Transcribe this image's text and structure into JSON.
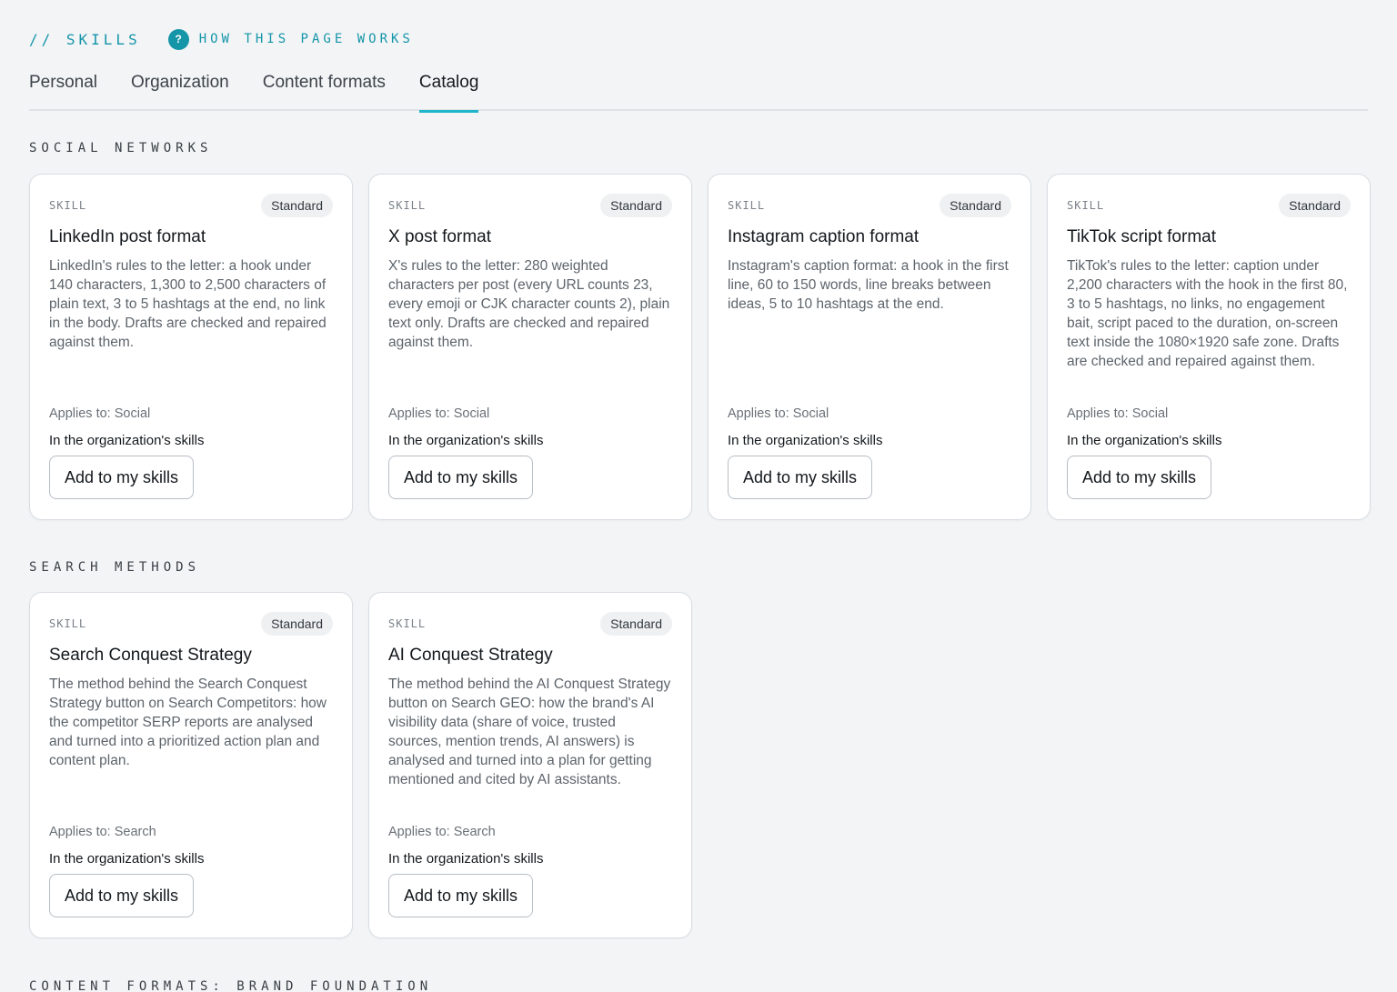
{
  "header": {
    "crumb": "// SKILLS",
    "help_icon_glyph": "?",
    "help_label": "HOW THIS PAGE WORKS"
  },
  "tabs": [
    {
      "label": "Personal",
      "active": false
    },
    {
      "label": "Organization",
      "active": false
    },
    {
      "label": "Content formats",
      "active": false
    },
    {
      "label": "Catalog",
      "active": true
    }
  ],
  "colors": {
    "accent": "#1595a8",
    "tab_underline": "#1fb6cc",
    "background": "#f2f4f6"
  },
  "sections": [
    {
      "title": "SOCIAL NETWORKS",
      "cards": [
        {
          "kind": "SKILL",
          "badge": "Standard",
          "title": "LinkedIn post format",
          "description": "LinkedIn's rules to the letter: a hook under 140 characters, 1,300 to 2,500 characters of plain text, 3 to 5 hashtags at the end, no link in the body. Drafts are checked and repaired against them.",
          "applies": "Applies to: Social",
          "status": "In the organization's skills",
          "button": "Add to my skills"
        },
        {
          "kind": "SKILL",
          "badge": "Standard",
          "title": "X post format",
          "description": "X's rules to the letter: 280 weighted characters per post (every URL counts 23, every emoji or CJK character counts 2), plain text only. Drafts are checked and repaired against them.",
          "applies": "Applies to: Social",
          "status": "In the organization's skills",
          "button": "Add to my skills"
        },
        {
          "kind": "SKILL",
          "badge": "Standard",
          "title": "Instagram caption format",
          "description": "Instagram's caption format: a hook in the first line, 60 to 150 words, line breaks between ideas, 5 to 10 hashtags at the end.",
          "applies": "Applies to: Social",
          "status": "In the organization's skills",
          "button": "Add to my skills"
        },
        {
          "kind": "SKILL",
          "badge": "Standard",
          "title": "TikTok script format",
          "description": "TikTok's rules to the letter: caption under 2,200 characters with the hook in the first 80, 3 to 5 hashtags, no links, no engagement bait, script paced to the duration, on-screen text inside the 1080×1920 safe zone. Drafts are checked and repaired against them.",
          "applies": "Applies to: Social",
          "status": "In the organization's skills",
          "button": "Add to my skills"
        }
      ]
    },
    {
      "title": "SEARCH METHODS",
      "cards": [
        {
          "kind": "SKILL",
          "badge": "Standard",
          "title": "Search Conquest Strategy",
          "description": "The method behind the Search Conquest Strategy button on Search Competitors: how the competitor SERP reports are analysed and turned into a prioritized action plan and content plan.",
          "applies": "Applies to: Search",
          "status": "In the organization's skills",
          "button": "Add to my skills"
        },
        {
          "kind": "SKILL",
          "badge": "Standard",
          "title": "AI Conquest Strategy",
          "description": "The method behind the AI Conquest Strategy button on Search GEO: how the brand's AI visibility data (share of voice, trusted sources, mention trends, AI answers) is analysed and turned into a plan for getting mentioned and cited by AI assistants.",
          "applies": "Applies to: Search",
          "status": "In the organization's skills",
          "button": "Add to my skills"
        }
      ]
    },
    {
      "title": "CONTENT FORMATS: BRAND FOUNDATION",
      "cards": []
    }
  ]
}
